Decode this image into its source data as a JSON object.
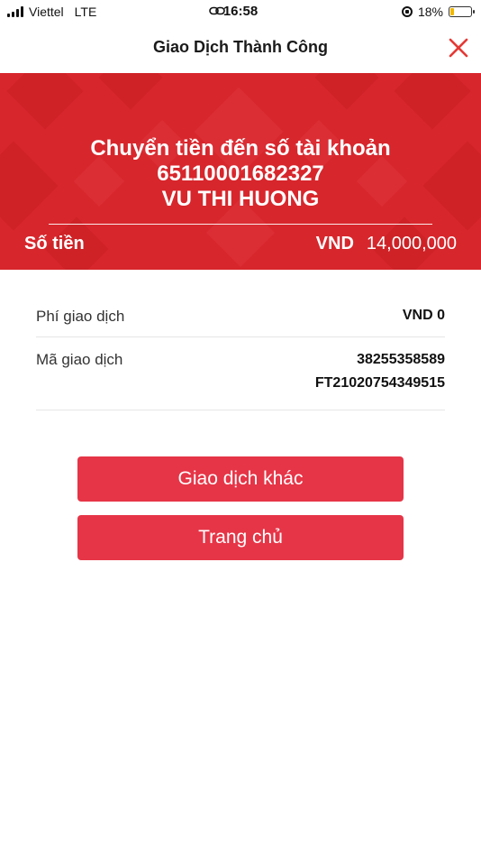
{
  "status_bar": {
    "carrier": "Viettel",
    "network": "LTE",
    "time": "16:58",
    "battery_percent": "18%",
    "battery_level": 0.18,
    "battery_color": "#f2b800"
  },
  "header": {
    "title": "Giao Dịch Thành Công",
    "close_icon": "close-icon",
    "close_color": "#e53935"
  },
  "banner": {
    "line1": "Chuyển tiền đến số tài khoản",
    "account_number": "65110001682327",
    "recipient_name": "VU THI HUONG",
    "amount_label": "Số tiền",
    "currency": "VND",
    "amount": "14,000,000",
    "background_color": "#d7262c"
  },
  "details": [
    {
      "label": "Phí giao dịch",
      "value_lines": [
        "VND 0"
      ]
    },
    {
      "label": "Mã giao dịch",
      "value_lines": [
        "38255358589",
        "FT21020754349515"
      ]
    }
  ],
  "buttons": {
    "other_transaction": "Giao dịch khác",
    "home": "Trang chủ",
    "color": "#e63547"
  }
}
